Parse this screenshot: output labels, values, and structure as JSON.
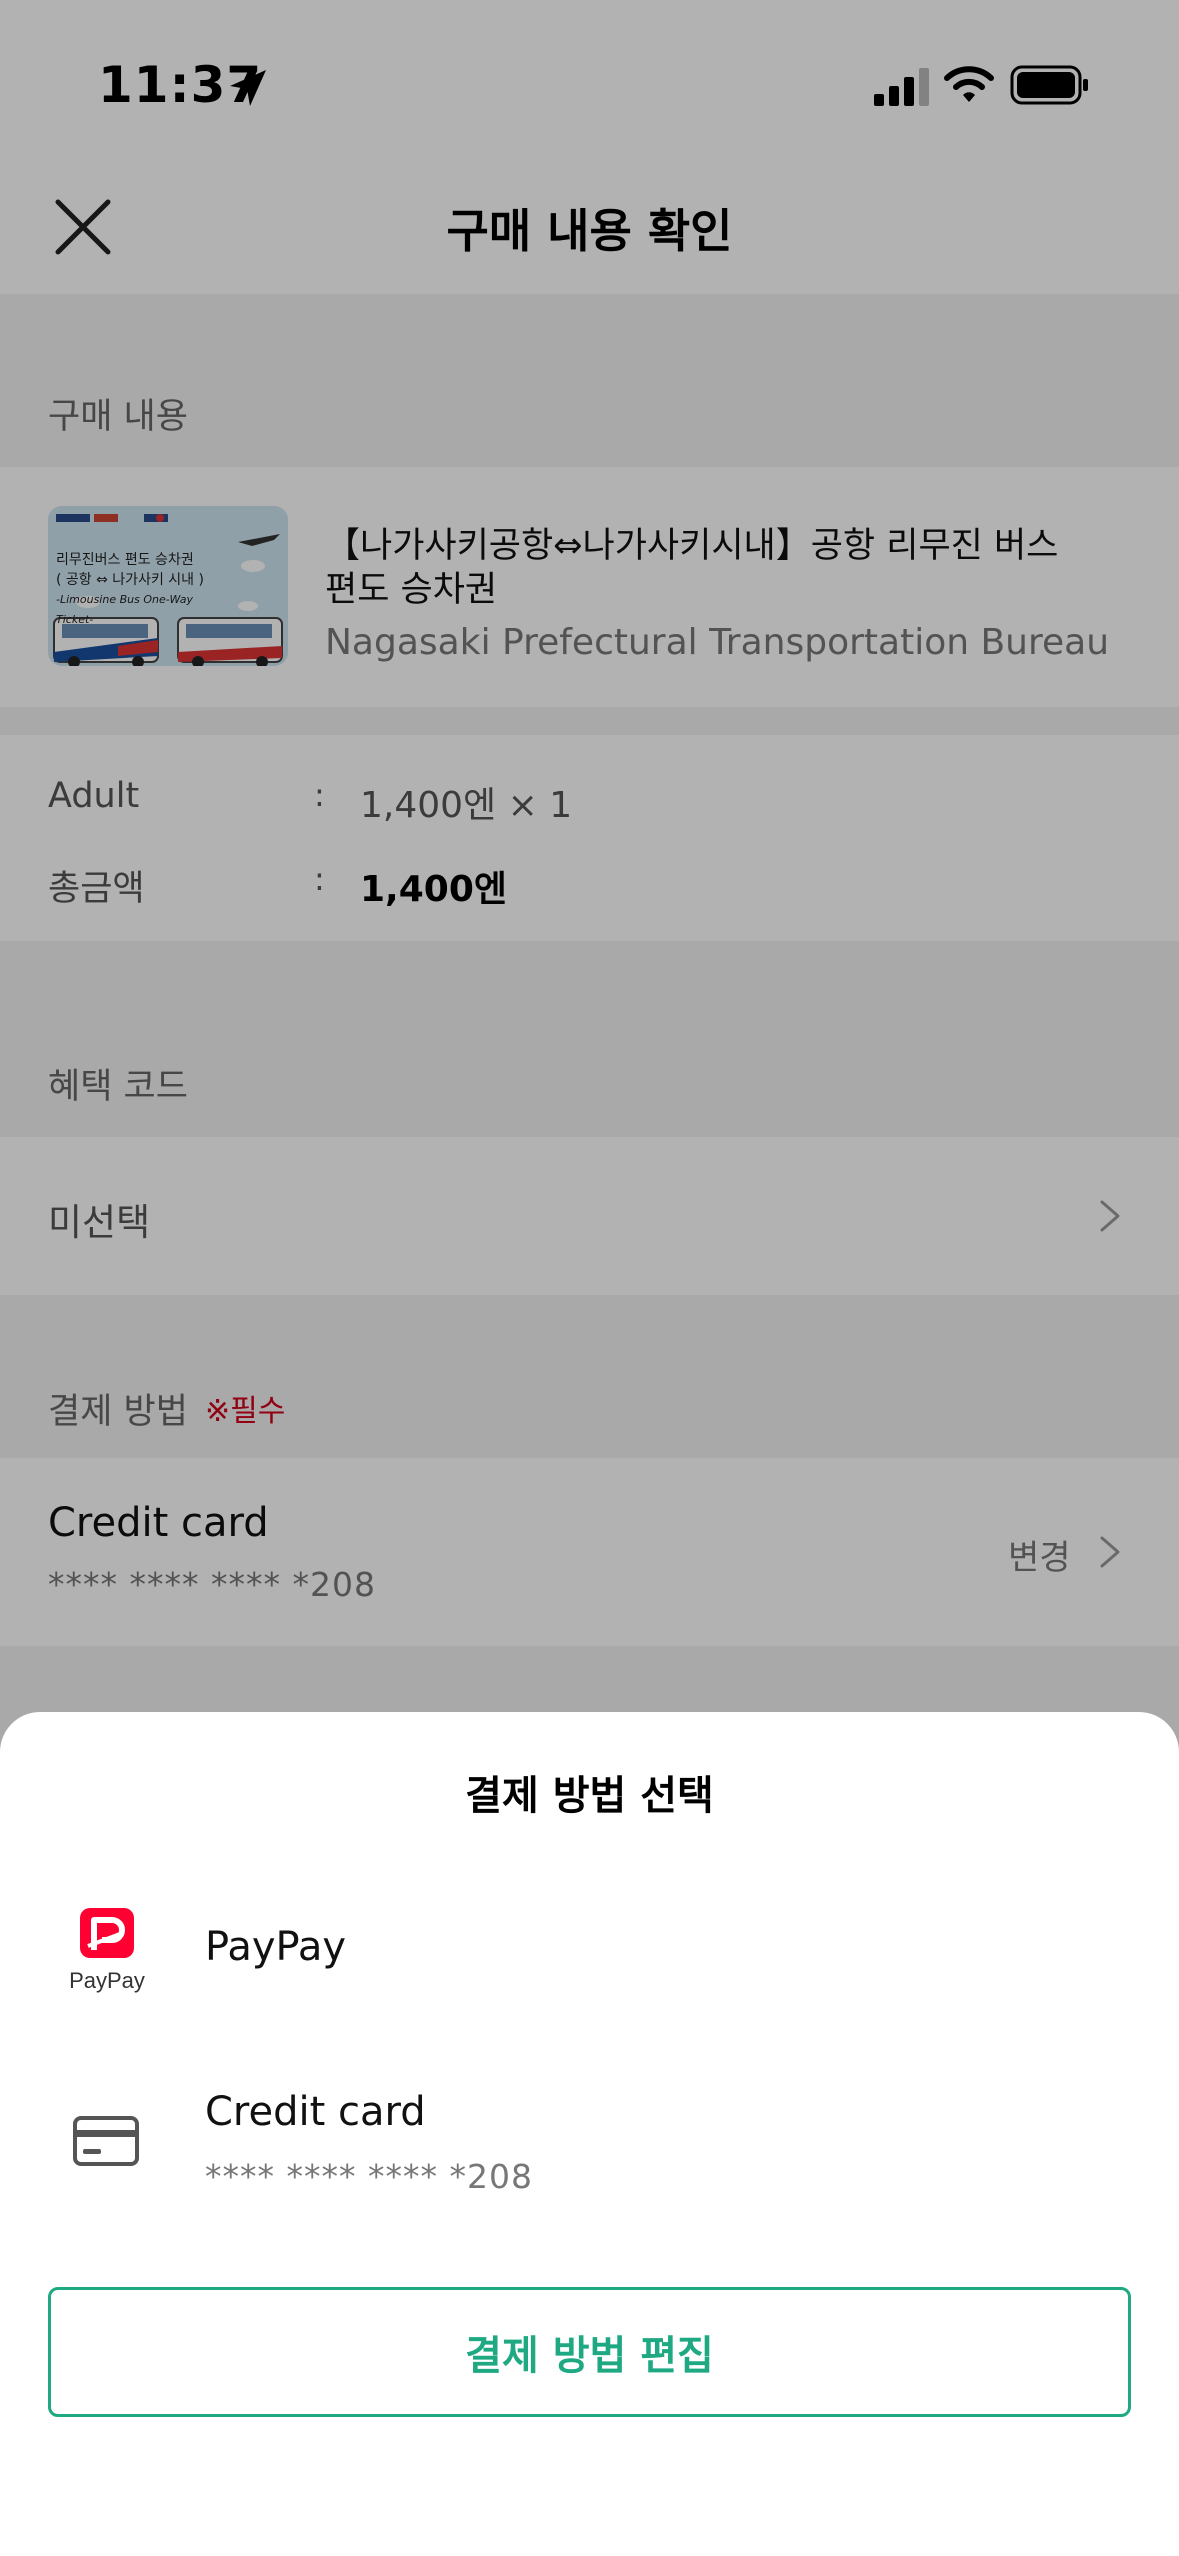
{
  "status_bar": {
    "time": "11:37"
  },
  "header": {
    "title": "구매 내용 확인"
  },
  "purchase_section": {
    "label": "구매 내용",
    "product_title": "【나가사키공항⇔나가사키시내】공항 리무진 버스 편도 승차권",
    "product_operator": "Nagasaki Prefectural Transportation Bureau",
    "thumbnail": {
      "line1": "리무진버스 편도 승차권",
      "line2": "( 공항 ⇔ 나가사키 시내 )",
      "line3": "-Limousine Bus One-Way Ticket-"
    }
  },
  "price": {
    "adult_label": "Adult",
    "adult_value": "1,400엔 × 1",
    "total_label": "총금액",
    "total_value": "1,400엔",
    "colon": ":"
  },
  "coupon_section": {
    "label": "혜택 코드",
    "value": "미선택"
  },
  "payment_section": {
    "label": "결제 방법",
    "required": "※필수",
    "method": "Credit card",
    "card_number": "**** **** **** *208",
    "change_label": "변경"
  },
  "sheet": {
    "title": "결제 방법 선택",
    "options": [
      {
        "label": "PayPay",
        "icon": "paypay-logo",
        "logo_text": "PayPay"
      },
      {
        "label": "Credit card",
        "sub": "**** **** **** *208",
        "icon": "credit-card-icon"
      }
    ],
    "edit_button": "결제 방법 편집"
  },
  "colors": {
    "accent": "#1ea982",
    "required": "#d0021b",
    "paypay": "#ff0033"
  }
}
